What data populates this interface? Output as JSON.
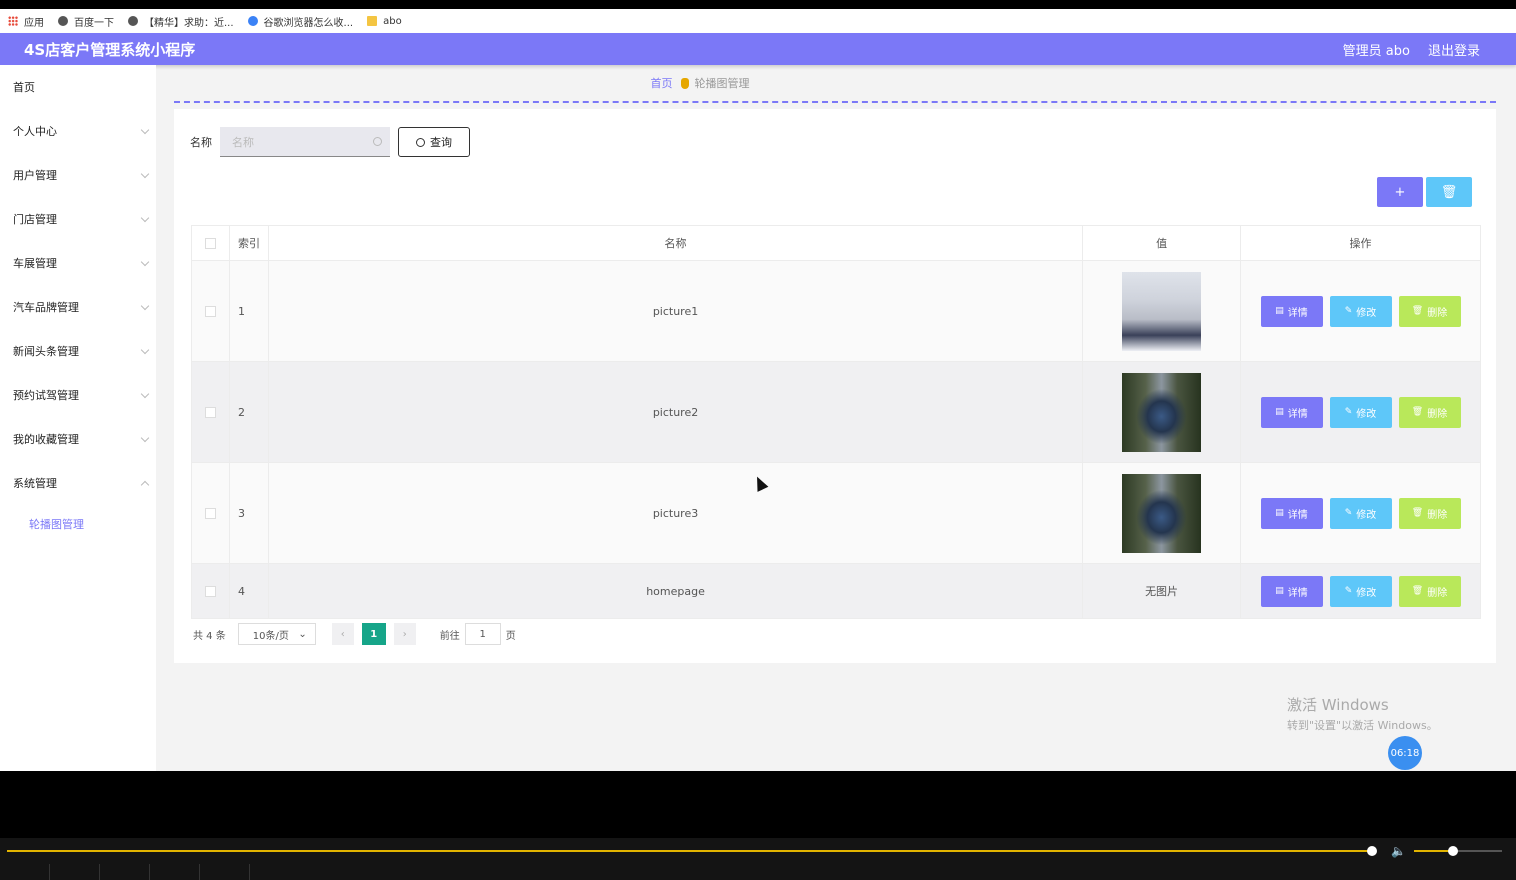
{
  "bookmarks": [
    {
      "label": "应用",
      "icon": "apps-icon"
    },
    {
      "label": "百度一下",
      "icon": "globe-icon"
    },
    {
      "label": "【精华】求助：近...",
      "icon": "globe-icon"
    },
    {
      "label": "谷歌浏览器怎么收...",
      "icon": "paw-icon"
    },
    {
      "label": "abo",
      "icon": "folder-icon"
    }
  ],
  "header": {
    "title": "4S店客户管理系统小程序",
    "user": "管理员 abo",
    "logout": "退出登录"
  },
  "sidebar": {
    "items": [
      {
        "label": "首页"
      },
      {
        "label": "个人中心"
      },
      {
        "label": "用户管理"
      },
      {
        "label": "门店管理"
      },
      {
        "label": "车展管理"
      },
      {
        "label": "汽车品牌管理"
      },
      {
        "label": "新闻头条管理"
      },
      {
        "label": "预约试驾管理"
      },
      {
        "label": "我的收藏管理"
      },
      {
        "label": "系统管理"
      }
    ],
    "submenu": {
      "label": "轮播图管理"
    }
  },
  "breadcrumb": {
    "home": "首页",
    "current": "轮播图管理"
  },
  "search": {
    "label": "名称",
    "placeholder": "名称",
    "button": "查询"
  },
  "actions": {
    "add": "+",
    "delete": "🗑"
  },
  "table": {
    "headers": {
      "index": "索引",
      "name": "名称",
      "value": "值",
      "ops": "操作"
    },
    "rows": [
      {
        "index": "1",
        "name": "picture1",
        "value": "",
        "thumb": "anime-portrait"
      },
      {
        "index": "2",
        "name": "picture2",
        "value": "",
        "thumb": "car-photo"
      },
      {
        "index": "3",
        "name": "picture3",
        "value": "",
        "thumb": "car-photo"
      },
      {
        "index": "4",
        "name": "homepage",
        "value": "无图片",
        "thumb": ""
      }
    ],
    "ops": {
      "detail": "详情",
      "edit": "修改",
      "remove": "删除"
    }
  },
  "pager": {
    "total": "共 4 条",
    "size": "10条/页",
    "page": "1",
    "goto": "前往",
    "goto_value": "1",
    "page_unit": "页"
  },
  "watermark": {
    "line1": "激活 Windows",
    "line2": "转到\"设置\"以激活 Windows。"
  },
  "player": {
    "time": "06:18"
  },
  "colors": {
    "primary": "#7b78f7",
    "info": "#5ec7f9",
    "danger": "#b9e85a",
    "pager_active": "#16a589"
  }
}
